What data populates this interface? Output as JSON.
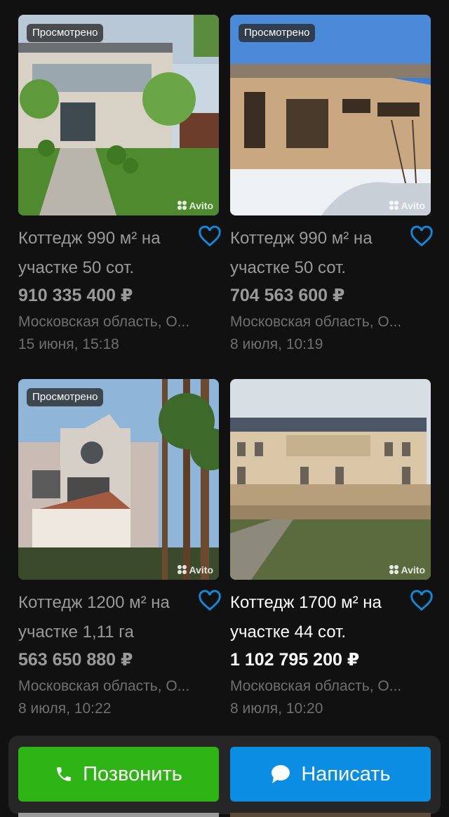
{
  "listings": [
    {
      "viewed": "Просмотрено",
      "title": "Коттедж 990 м² на участке 50 сот.",
      "price": "910 335 400 ₽",
      "location": "Московская область, О...",
      "date": "15 июня, 15:18",
      "watermark": "Avito",
      "favorite_icon": "heart-outline-icon"
    },
    {
      "viewed": "Просмотрено",
      "title": "Коттедж 990 м² на участке 50 сот.",
      "price": "704 563 600 ₽",
      "location": "Московская область, О...",
      "date": "8 июля, 10:19",
      "watermark": "Avito",
      "favorite_icon": "heart-outline-icon"
    },
    {
      "viewed": "Просмотрено",
      "title": "Коттедж 1200 м² на участке 1,11 га",
      "price": "563 650 880 ₽",
      "location": "Московская область, О...",
      "date": "8 июля, 10:22",
      "watermark": "Avito",
      "favorite_icon": "heart-outline-icon"
    },
    {
      "viewed": "",
      "title": "Коттедж 1700 м² на участке 44 сот.",
      "price": "1 102 795 200 ₽",
      "location": "Московская область, О...",
      "date": "8 июля, 10:20",
      "watermark": "Avito",
      "favorite_icon": "heart-outline-icon"
    }
  ],
  "actions": {
    "call_label": "Позвонить",
    "call_icon": "phone-icon",
    "write_label": "Написать",
    "write_icon": "chat-bubble-icon"
  },
  "colors": {
    "background": "#111111",
    "accent_blue": "#0a8de3",
    "call_green": "#2fb416",
    "viewed_text": "#9a9a9a"
  }
}
